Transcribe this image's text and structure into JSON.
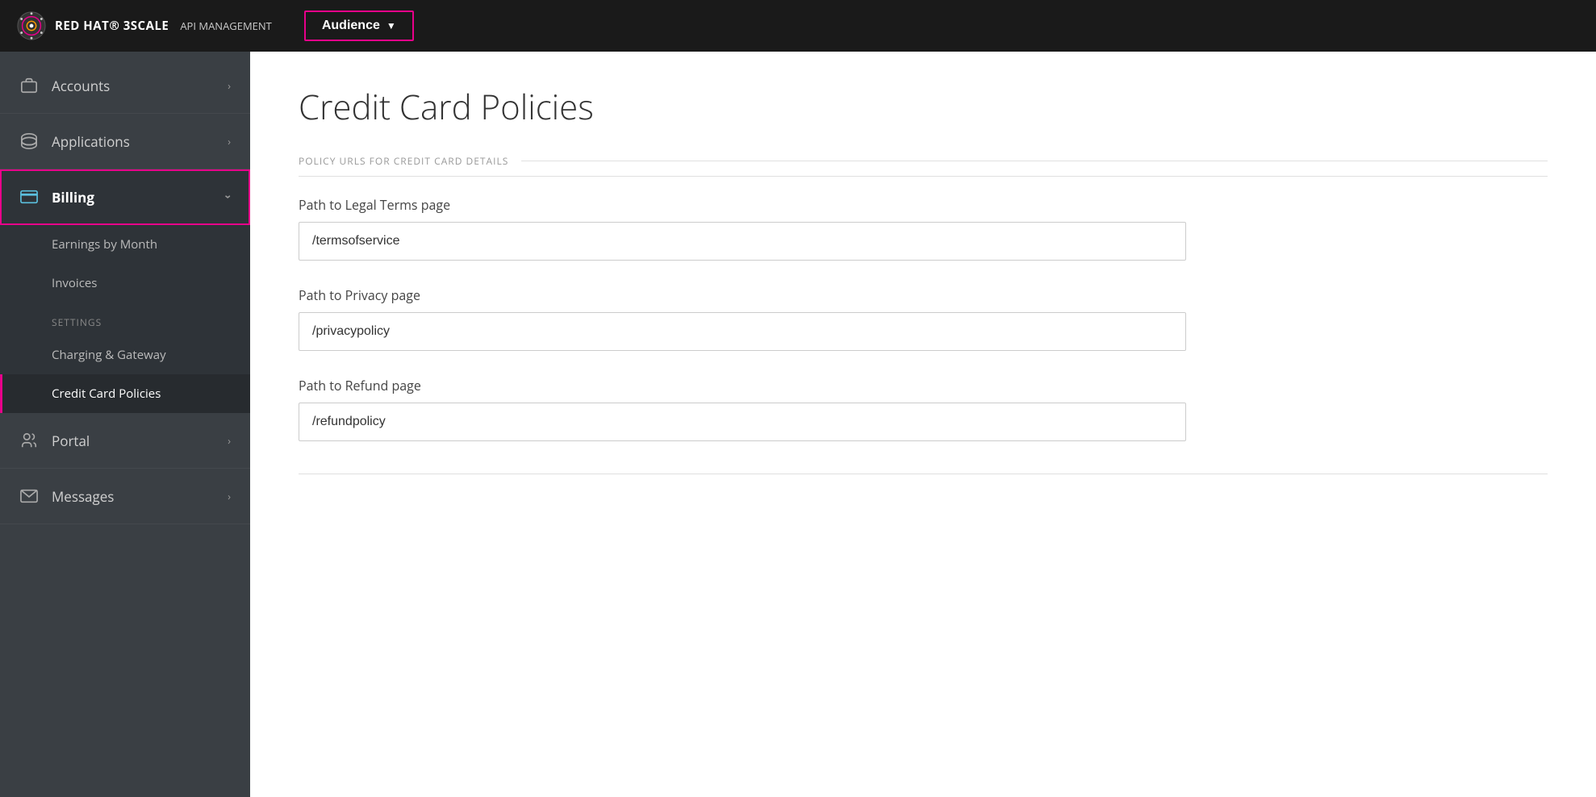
{
  "brand": {
    "name": "RED HAT® 3SCALE",
    "sub": "API MANAGEMENT"
  },
  "audience_button": "Audience",
  "sidebar": {
    "items": [
      {
        "id": "accounts",
        "label": "Accounts",
        "icon": "briefcase",
        "hasChevron": true,
        "active": false
      },
      {
        "id": "applications",
        "label": "Applications",
        "icon": "apps",
        "hasChevron": true,
        "active": false
      },
      {
        "id": "billing",
        "label": "Billing",
        "icon": "credit-card",
        "hasChevron": true,
        "active": true,
        "subitems": [
          {
            "id": "earnings",
            "label": "Earnings by Month"
          },
          {
            "id": "invoices",
            "label": "Invoices"
          }
        ],
        "settings_label": "Settings",
        "settings_items": [
          {
            "id": "charging-gateway",
            "label": "Charging & Gateway",
            "active": false
          },
          {
            "id": "credit-card-policies",
            "label": "Credit Card Policies",
            "active": true
          }
        ]
      },
      {
        "id": "portal",
        "label": "Portal",
        "icon": "portal",
        "hasChevron": true,
        "active": false
      },
      {
        "id": "messages",
        "label": "Messages",
        "icon": "envelope",
        "hasChevron": true,
        "active": false
      }
    ]
  },
  "page": {
    "title": "Credit Card Policies",
    "section_label": "POLICY URLS FOR CREDIT CARD DETAILS",
    "fields": [
      {
        "id": "legal-terms",
        "label": "Path to Legal Terms page",
        "value": "/termsofservice",
        "placeholder": "/termsofservice"
      },
      {
        "id": "privacy",
        "label": "Path to Privacy page",
        "value": "/privacypolicy",
        "placeholder": "/privacypolicy"
      },
      {
        "id": "refund",
        "label": "Path to Refund page",
        "value": "/refundpolicy",
        "placeholder": "/refundpolicy"
      }
    ]
  }
}
